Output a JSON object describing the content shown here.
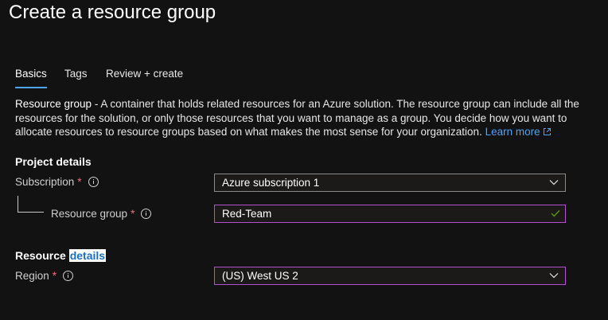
{
  "page": {
    "title": "Create a resource group"
  },
  "tabs": [
    {
      "label": "Basics"
    },
    {
      "label": "Tags"
    },
    {
      "label": "Review + create"
    }
  ],
  "description": {
    "lead": "Resource group",
    "text": " - A container that holds related resources for an Azure solution. The resource group can include all the resources for the solution, or only those resources that you want to manage as a group. You decide how you want to allocate resources to resource groups based on what makes the most sense for your organization. ",
    "link_text": "Learn more",
    "link_icon": "external-link-icon"
  },
  "project_details": {
    "heading": "Project details",
    "subscription": {
      "label": "Subscription",
      "required_mark": "*",
      "value": "Azure subscription 1"
    },
    "resource_group": {
      "label": "Resource group",
      "required_mark": "*",
      "value": "Red-Team",
      "valid": true
    }
  },
  "resource_details": {
    "heading_plain": "Resource",
    "heading_highlight": "details",
    "region": {
      "label": "Region",
      "required_mark": "*",
      "value": "(US) West US 2"
    }
  },
  "colors": {
    "background": "#121212",
    "accent": "#4ea2f0",
    "required": "#f1707b",
    "focus_border": "#b44fd4",
    "valid_check": "#57a300"
  }
}
